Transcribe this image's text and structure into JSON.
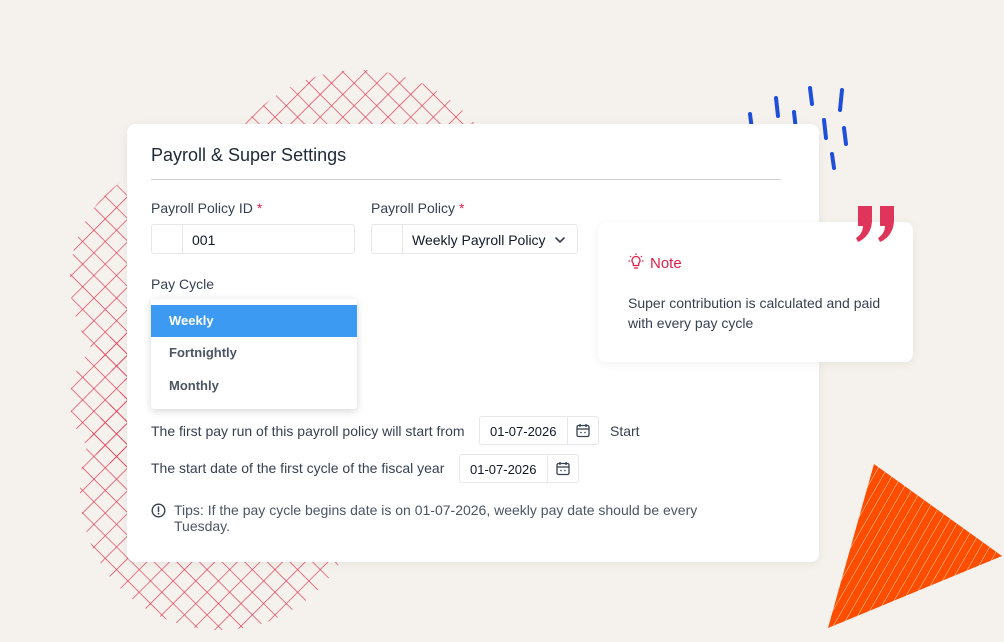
{
  "card": {
    "title": "Payroll & Super Settings",
    "policy_id": {
      "label": "Payroll Policy ID",
      "required_mark": "*",
      "value": "001"
    },
    "policy": {
      "label": "Payroll Policy",
      "required_mark": "*",
      "value": "Weekly Payroll Policy"
    },
    "pay_cycle": {
      "label": "Pay Cycle",
      "options": [
        "Weekly",
        "Fortnightly",
        "Monthly"
      ],
      "selected": "Weekly"
    },
    "first_run": {
      "text": "The first pay run of this payroll policy will start from",
      "date": "01-07-2026",
      "suffix": "Start"
    },
    "fiscal": {
      "text": "The start date of the first cycle of the fiscal year",
      "date": "01-07-2026"
    },
    "tip": "Tips: If the pay cycle begins date is on 01-07-2026, weekly pay date should be every Tuesday."
  },
  "note": {
    "title": "Note",
    "body": "Super contribution is calculated and paid with every pay cycle"
  },
  "colors": {
    "accent_blue": "#3d9af2",
    "required_red": "#e11d48",
    "deco_orange": "#ff4d00",
    "deco_blue": "#1e4fd8",
    "deco_pink": "#e0354f",
    "background": "#f5f1ed"
  },
  "icons": {
    "chevron": "chevron-down-icon",
    "calendar": "calendar-icon",
    "tip": "info-circle-icon",
    "note": "lightbulb-icon",
    "quote": "quote-marks-icon"
  }
}
